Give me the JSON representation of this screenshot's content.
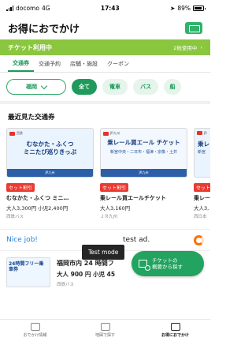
{
  "status_bar": {
    "carrier": "docomo",
    "network": "4G",
    "time": "17:43",
    "battery": "89%"
  },
  "header": {
    "title": "お得におでかけ",
    "ticket_icon": "ticket-icon"
  },
  "usage_bar": {
    "label": "チケット利用中",
    "count": "2枚使用中",
    "arrow": "›"
  },
  "tabs": [
    {
      "label": "交通券",
      "active": true
    },
    {
      "label": "交通予約",
      "active": false
    },
    {
      "label": "店舗・施設",
      "active": false
    },
    {
      "label": "クーポン",
      "active": false
    }
  ],
  "filters": {
    "region": "福岡",
    "chips": [
      {
        "label": "全て",
        "active": true
      },
      {
        "label": "電車",
        "active": false
      },
      {
        "label": "バス",
        "active": false
      },
      {
        "label": "船",
        "active": false
      }
    ]
  },
  "recent": {
    "title": "最近見た交通券",
    "cards": [
      {
        "brand": "西鉄",
        "headline": "むなかた・ふくつ",
        "headline2": "ミニたび巡りきっぷ",
        "strip": "JR九州",
        "badge": "セット割引",
        "name": "むなかた・ふくつ ミニ…",
        "price": "大人3,300円 小児2,400円",
        "company": "西鉄バス"
      },
      {
        "brand": "JR九州",
        "headline": "乗レール買エール チケット",
        "headline2": "新宮中央・二日市・福津・宗像・土井",
        "strip": "JR九州",
        "badge": "セット割引",
        "name": "乗レール買エールチケット",
        "price": "大人3,160円",
        "company": "ＪＲ九州"
      },
      {
        "brand": "JR",
        "headline": "乗レ",
        "headline2": "新宮",
        "strip": "",
        "badge": "セット",
        "name": "乗レー",
        "price": "大人3,",
        "company": "西日本"
      }
    ]
  },
  "ad": {
    "nice": "Nice job!",
    "text": "test ad.",
    "toast": "Test mode"
  },
  "list_item": {
    "image_label": "24時間フリー乗車券",
    "title": "福岡市内 24 時間フ",
    "price": "大人 900 円 小児 45",
    "company": "西鉄バス"
  },
  "fab": {
    "line1": "チケットの",
    "line2": "概要から探す"
  },
  "bottom_nav": [
    {
      "label": "おでかけ情報",
      "active": false
    },
    {
      "label": "地図で探す",
      "active": false
    },
    {
      "label": "お得におでかけ",
      "active": true
    }
  ]
}
